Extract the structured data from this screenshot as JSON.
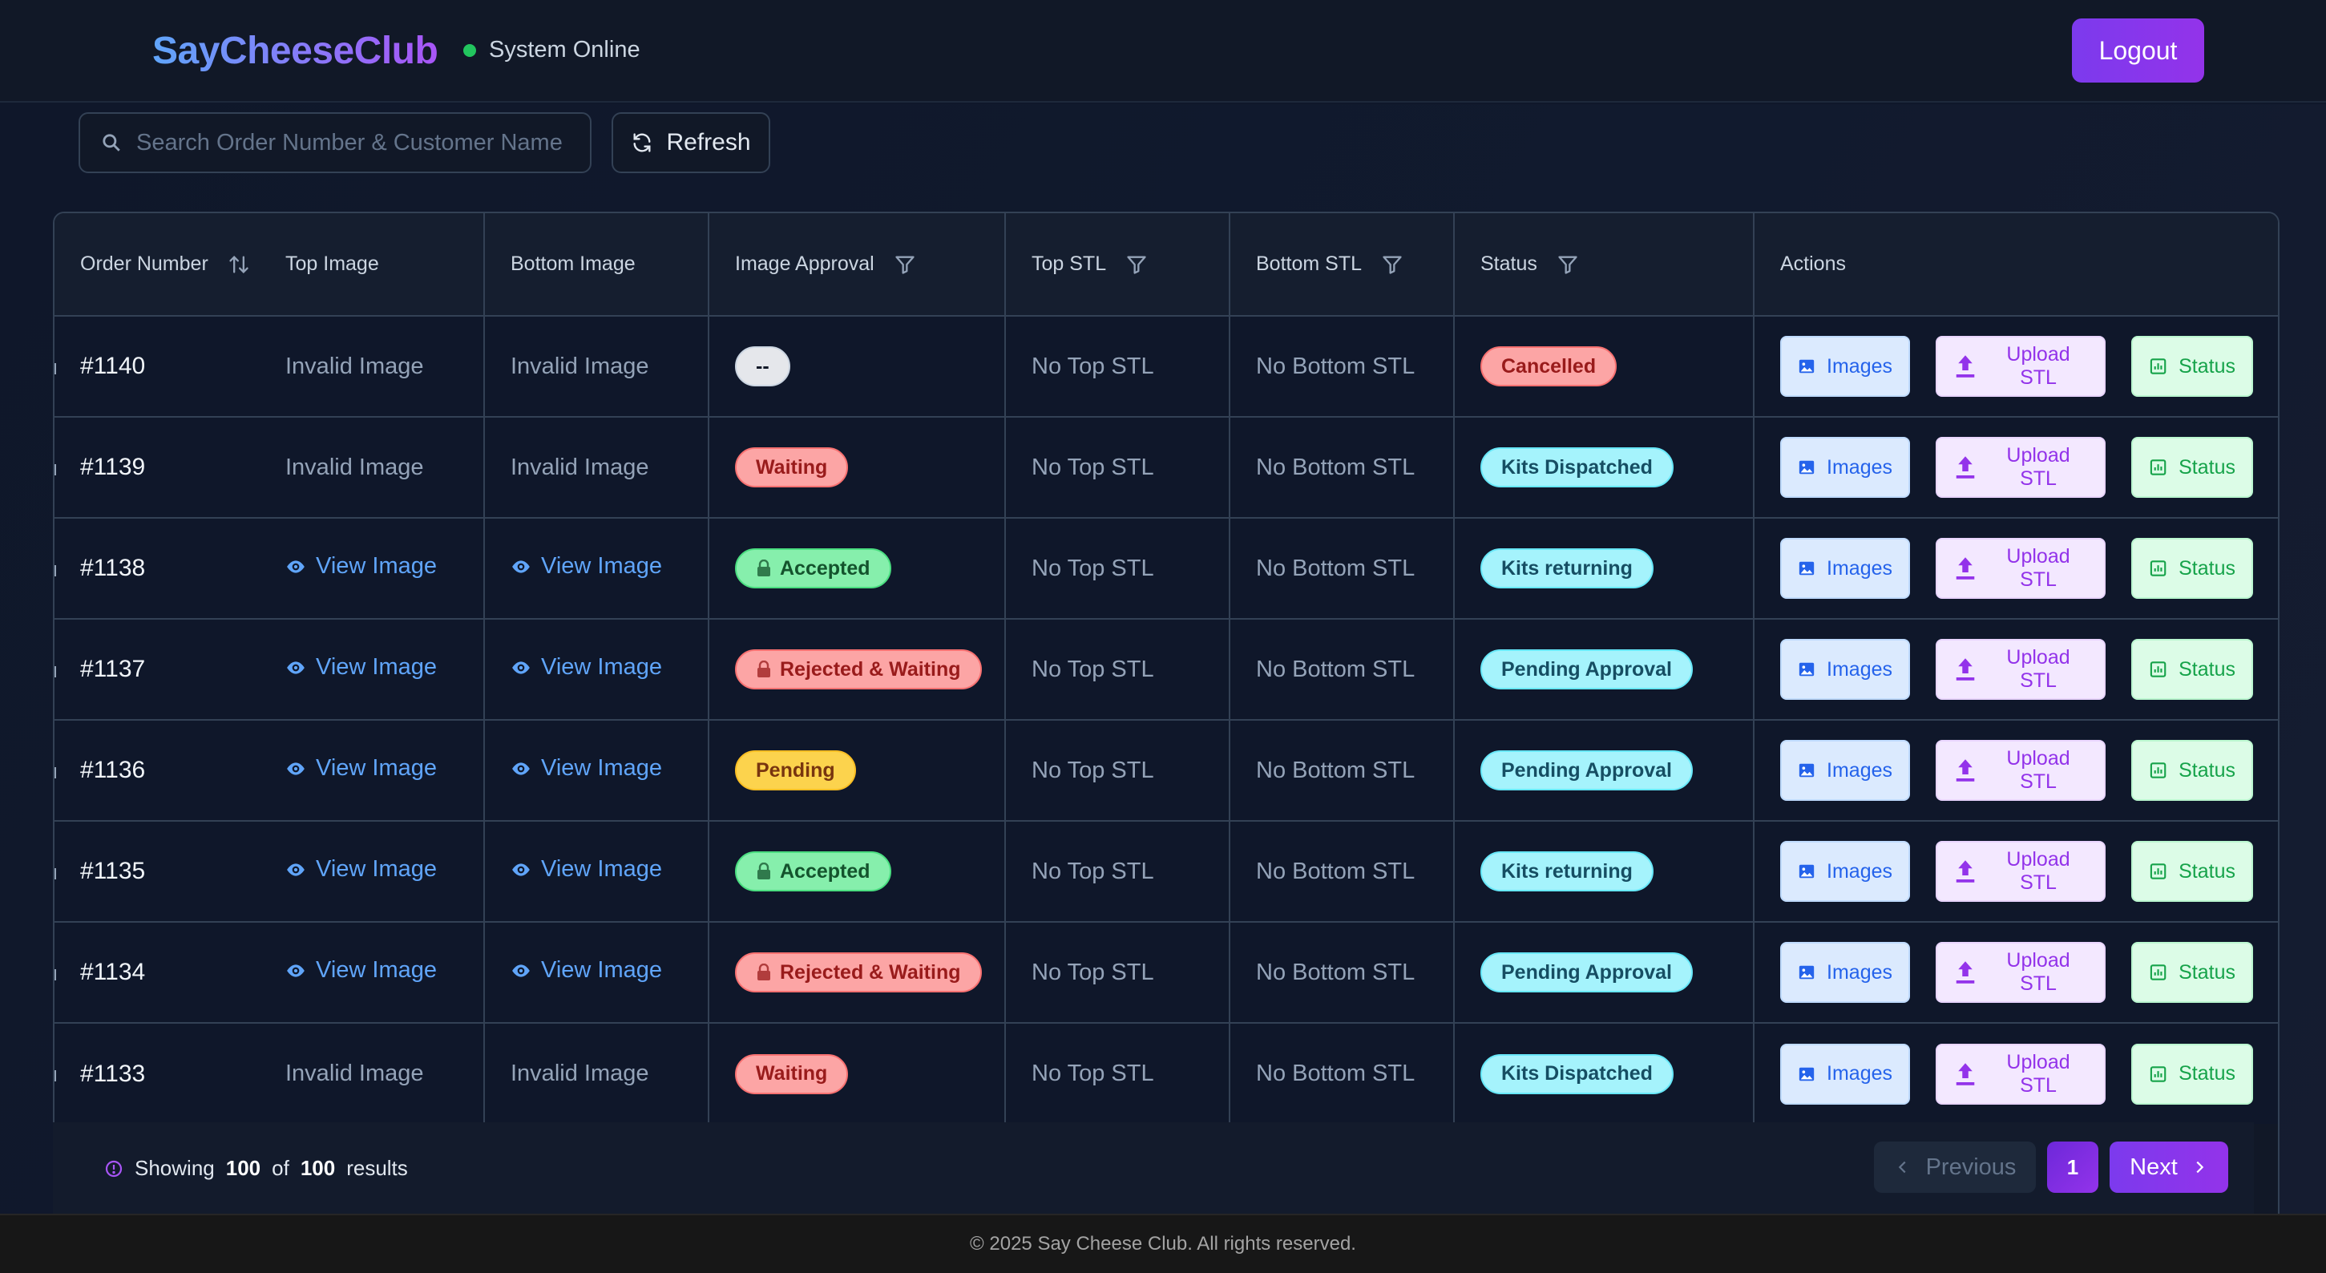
{
  "header": {
    "logo": "SayCheeseClub",
    "status_text": "System Online",
    "logout_label": "Logout"
  },
  "toolbar": {
    "search_placeholder": "Search Order Number & Customer Name",
    "refresh_label": "Refresh"
  },
  "table": {
    "columns": {
      "order_number": "Order Number",
      "top_image": "Top Image",
      "bottom_image": "Bottom Image",
      "image_approval": "Image Approval",
      "top_stl": "Top STL",
      "bottom_stl": "Bottom STL",
      "status": "Status",
      "actions": "Actions"
    },
    "action_labels": {
      "images": "Images",
      "upload_stl": "Upload STL",
      "status": "Status"
    },
    "rows": [
      {
        "order": "#1140",
        "top_image": "Invalid Image",
        "bottom_image": "Invalid Image",
        "approval": "--",
        "approval_style": "gray",
        "approval_lock": false,
        "top_stl": "No Top STL",
        "bottom_stl": "No Bottom STL",
        "status": "Cancelled",
        "status_style": "red"
      },
      {
        "order": "#1139",
        "top_image": "Invalid Image",
        "bottom_image": "Invalid Image",
        "approval": "Waiting",
        "approval_style": "red",
        "approval_lock": false,
        "top_stl": "No Top STL",
        "bottom_stl": "No Bottom STL",
        "status": "Kits Dispatched",
        "status_style": "cyan"
      },
      {
        "order": "#1138",
        "top_image": "View Image",
        "bottom_image": "View Image",
        "approval": "Accepted",
        "approval_style": "green",
        "approval_lock": true,
        "top_stl": "No Top STL",
        "bottom_stl": "No Bottom STL",
        "status": "Kits returning",
        "status_style": "cyan"
      },
      {
        "order": "#1137",
        "top_image": "View Image",
        "bottom_image": "View Image",
        "approval": "Rejected & Waiting",
        "approval_style": "red",
        "approval_lock": true,
        "top_stl": "No Top STL",
        "bottom_stl": "No Bottom STL",
        "status": "Pending Approval",
        "status_style": "cyan"
      },
      {
        "order": "#1136",
        "top_image": "View Image",
        "bottom_image": "View Image",
        "approval": "Pending",
        "approval_style": "yellow",
        "approval_lock": false,
        "top_stl": "No Top STL",
        "bottom_stl": "No Bottom STL",
        "status": "Pending Approval",
        "status_style": "cyan"
      },
      {
        "order": "#1135",
        "top_image": "View Image",
        "bottom_image": "View Image",
        "approval": "Accepted",
        "approval_style": "green",
        "approval_lock": true,
        "top_stl": "No Top STL",
        "bottom_stl": "No Bottom STL",
        "status": "Kits returning",
        "status_style": "cyan"
      },
      {
        "order": "#1134",
        "top_image": "View Image",
        "bottom_image": "View Image",
        "approval": "Rejected & Waiting",
        "approval_style": "red",
        "approval_lock": true,
        "top_stl": "No Top STL",
        "bottom_stl": "No Bottom STL",
        "status": "Pending Approval",
        "status_style": "cyan"
      },
      {
        "order": "#1133",
        "top_image": "Invalid Image",
        "bottom_image": "Invalid Image",
        "approval": "Waiting",
        "approval_style": "red",
        "approval_lock": false,
        "top_stl": "No Top STL",
        "bottom_stl": "No Bottom STL",
        "status": "Kits Dispatched",
        "status_style": "cyan"
      }
    ]
  },
  "pagination": {
    "showing_prefix": "Showing",
    "shown": "100",
    "of_word": "of",
    "total": "100",
    "results_word": "results",
    "previous_label": "Previous",
    "current_page": "1",
    "next_label": "Next"
  },
  "footer": {
    "copyright": "© 2025 Say Cheese Club. All rights reserved."
  },
  "colors": {
    "accent": "#7c3aed",
    "online": "#22c55e",
    "link": "#60a5fa"
  }
}
